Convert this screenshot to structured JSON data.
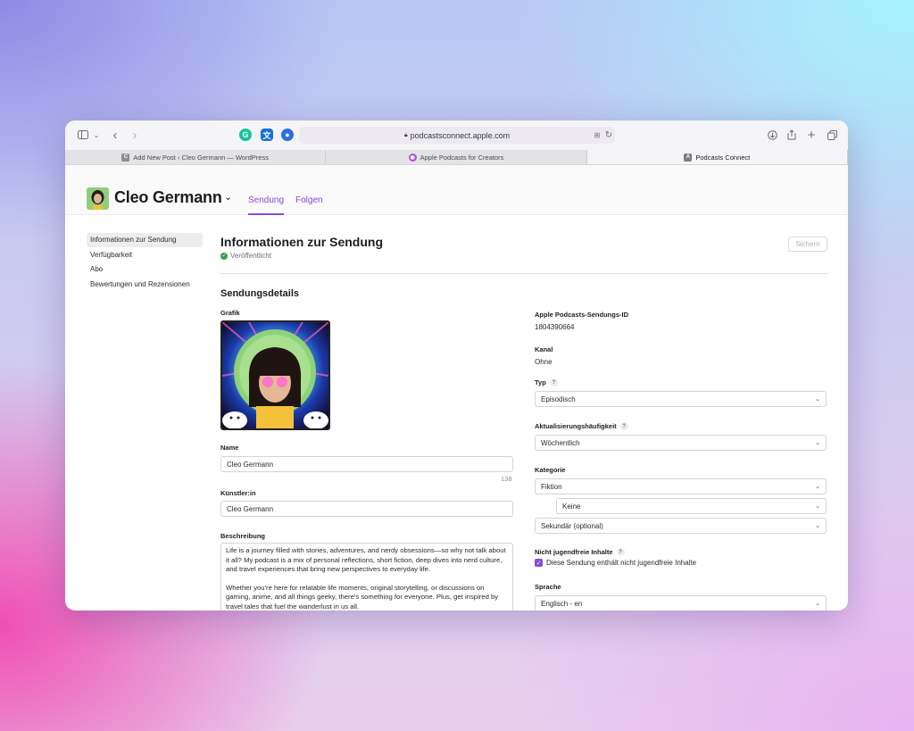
{
  "browser": {
    "url": "podcastsconnect.apple.com",
    "tabs": [
      {
        "label": "Add New Post ‹ Cleo Germann — WordPress",
        "icon": "wordpress-icon",
        "active": false
      },
      {
        "label": "Apple Podcasts for Creators",
        "icon": "apple-podcasts-icon",
        "active": false
      },
      {
        "label": "Podcasts Connect",
        "icon": "podcasts-connect-icon",
        "active": true
      }
    ]
  },
  "header": {
    "show_name": "Cleo Germann",
    "nav": [
      "Sendung",
      "Folgen"
    ]
  },
  "sidebar": {
    "items": [
      "Informationen zur Sendung",
      "Verfügbarkeit",
      "Abo",
      "Bewertungen und Rezensionen"
    ]
  },
  "main": {
    "title": "Informationen zur Sendung",
    "status": "Veröffentlicht",
    "save_label": "Sichern",
    "section_title": "Sendungsdetails",
    "artwork_label": "Grafik",
    "name_label": "Name",
    "name_value": "Cleo Germann",
    "name_count": "138",
    "artist_label": "Künstler:in",
    "artist_value": "Cleo Germann",
    "description_label": "Beschreibung",
    "description_p1": "Life is a journey filled with stories, adventures, and nerdy obsessions—so why not talk about it all? My podcast is a mix of personal reflections, short fiction, deep dives into nerd culture, and travel experiences that bring new perspectives to everyday life.",
    "description_p2": "Whether you're here for relatable life moments, original storytelling, or discussions on gaming, anime, and all things geeky, there's something for everyone. Plus, get inspired by travel tales that fuel the wanderlust in us all."
  },
  "details": {
    "id_label": "Apple Podcasts-Sendungs-ID",
    "id_value": "1804390664",
    "channel_label": "Kanal",
    "channel_value": "Ohne",
    "type_label": "Typ",
    "type_value": "Episodisch",
    "frequency_label": "Aktualisierungshäufigkeit",
    "frequency_value": "Wöchentlich",
    "category_label": "Kategorie",
    "category_value": "Fiktion",
    "subcategory_value": "Keine",
    "secondary_value": "Sekundär (optional)",
    "explicit_label": "Nicht jugendfreie Inhalte",
    "explicit_checkbox_label": "Diese Sendung enthält nicht jugendfreie Inhalte",
    "explicit_checked": true,
    "language_label": "Sprache",
    "language_value": "Englisch - en"
  },
  "colors": {
    "accent": "#8a4bd6",
    "success": "#30a14e"
  }
}
